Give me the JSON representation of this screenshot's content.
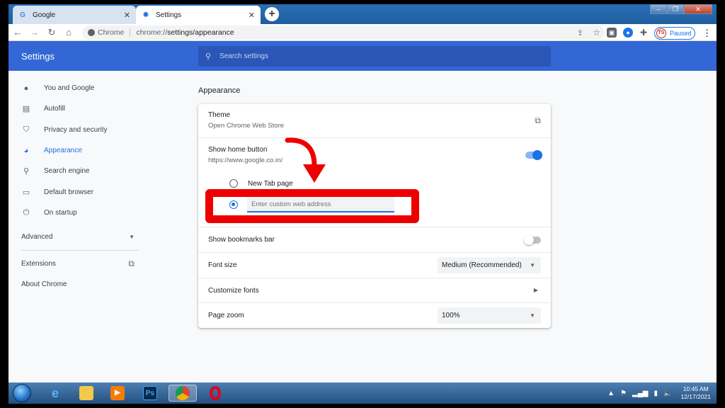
{
  "browser": {
    "tabs": [
      {
        "title": "Google",
        "favicon": "google-g-icon"
      },
      {
        "title": "Settings",
        "favicon": "settings-gear-icon"
      }
    ],
    "address": {
      "site_label": "Chrome",
      "url_scheme": "chrome://",
      "url_path": "settings/appearance"
    },
    "profile_label": "Paused",
    "profile_initials": "TS"
  },
  "header": {
    "title": "Settings",
    "search_placeholder": "Search settings"
  },
  "sidebar": {
    "items": [
      {
        "label": "You and Google",
        "icon": "person-icon"
      },
      {
        "label": "Autofill",
        "icon": "clipboard-icon"
      },
      {
        "label": "Privacy and security",
        "icon": "shield-icon"
      },
      {
        "label": "Appearance",
        "icon": "palette-icon"
      },
      {
        "label": "Search engine",
        "icon": "search-icon"
      },
      {
        "label": "Default browser",
        "icon": "browser-window-icon"
      },
      {
        "label": "On startup",
        "icon": "power-icon"
      }
    ],
    "advanced_label": "Advanced",
    "extensions_label": "Extensions",
    "about_label": "About Chrome"
  },
  "appearance": {
    "section_title": "Appearance",
    "theme": {
      "label": "Theme",
      "sub": "Open Chrome Web Store"
    },
    "home_button": {
      "label": "Show home button",
      "sub": "https://www.google.co.in/",
      "enabled": true
    },
    "home_options": {
      "new_tab_label": "New Tab page",
      "custom_placeholder": "Enter custom web address",
      "selected": "custom"
    },
    "bookmarks_bar": {
      "label": "Show bookmarks bar",
      "enabled": false
    },
    "font_size": {
      "label": "Font size",
      "value": "Medium (Recommended)"
    },
    "customize_fonts": {
      "label": "Customize fonts"
    },
    "page_zoom": {
      "label": "Page zoom",
      "value": "100%"
    }
  },
  "annotation": {
    "highlight_color": "#ee0000"
  },
  "taskbar": {
    "clock_time": "10:45 AM",
    "clock_date": "12/17/2021",
    "pinned": [
      "internet-explorer-icon",
      "folder-icon",
      "media-player-icon",
      "photoshop-icon",
      "chrome-icon",
      "opera-icon"
    ],
    "photoshop_label": "Ps"
  },
  "colors": {
    "accent": "#1a73e8",
    "header_blue": "#3367d6"
  }
}
